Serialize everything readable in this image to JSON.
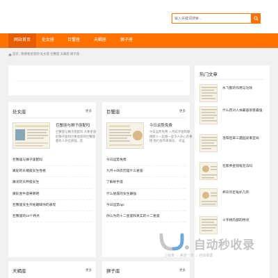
{
  "search": {
    "placeholder": "输入关键词搜索..."
  },
  "nav": {
    "items": [
      {
        "label": "网站首页"
      },
      {
        "label": "处女座"
      },
      {
        "label": "巨蟹座"
      },
      {
        "label": "天蝎座"
      },
      {
        "label": "狮子座"
      }
    ]
  },
  "breadcrumb": {
    "home": "首页",
    "current": "我要看星座吧 处女座 巨蟹座 天蝎座 狮子座"
  },
  "cards": {
    "virgo": {
      "title": "处女座",
      "more": "更多",
      "feature_title": "巨蟹座与狮子座配吗",
      "feature_desc": "巨蟹座与狮子座配吗 大象星座的狮子座和巨象星座的巨蟹座 都给人外在很强...温",
      "items": [
        "巨蟹座与狮子座配吗",
        "属处的水瓶座女生性格",
        "属龙的天秤座女生",
        "属蛇金牛座男哪吧",
        "巨蟹座女生开始暧昧你的表现",
        "巨蟹座的10个特点"
      ]
    },
    "cancer": {
      "title": "巨蟹座",
      "more": "更多",
      "feature_title": "今日运势免费",
      "feature_desc": "今日运势免费 一月双子座和摩羯座人一起她一些令人开心的事情 他们会带来快乐。 幸运",
      "items": [
        "今日运势免费",
        "九月十四农历是什么星座",
        "了解射手座",
        "什么星座的女生最强",
        "今日运势api",
        "你认为的十二星座和真实的十二星座"
      ]
    },
    "scorpio": {
      "title": "天蝎座",
      "more": "更多"
    },
    "leo": {
      "title": "狮子座",
      "more": "更多"
    }
  },
  "sidebar": {
    "title": "热门文章",
    "items": [
      {
        "title": "水飞蓟的作用与功效"
      },
      {
        "title": "什么药对人体最容易害最强"
      },
      {
        "title": "洛阳后翠三遇园皮事宜局"
      },
      {
        "title": "在家养金钱龟犯法吗"
      },
      {
        "title": "养双鸡巨龟扒几年"
      },
      {
        "title": "十字绣内部的特点"
      }
    ]
  },
  "watermark": {
    "text": "自动秒收录",
    "sub": "上线率 → 来访一次 → 自动收录"
  },
  "colors": {
    "accent": "#ff7200",
    "nav_active": "#e65c00"
  }
}
